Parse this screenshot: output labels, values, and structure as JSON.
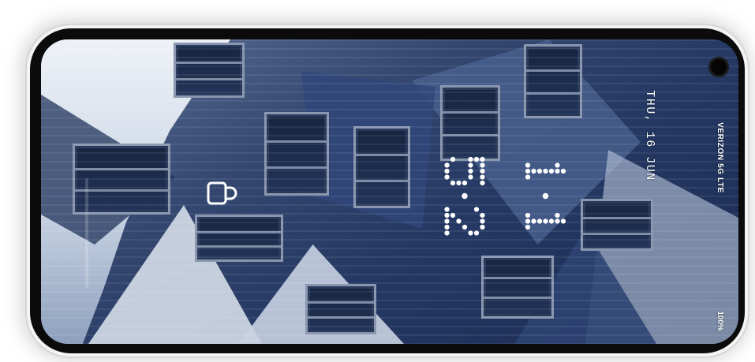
{
  "lock_screen": {
    "date": "THU, 16 JUN",
    "carrier": "VERIZON 5G LTE",
    "battery": "100%",
    "clock": {
      "hours": "11",
      "minutes": "52"
    },
    "widget_icon": "coffee-mug-icon"
  },
  "colors": {
    "text": "#ffffff",
    "frame": "#f4f4f4",
    "bezel": "#0b0b0b"
  }
}
